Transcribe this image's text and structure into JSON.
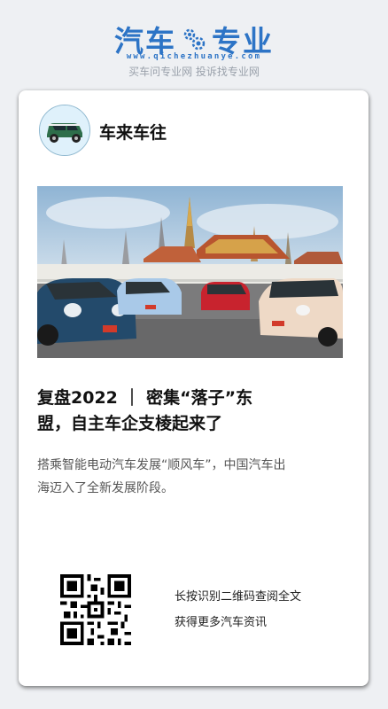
{
  "brand": {
    "logo_left": "汽车",
    "logo_right": "专业",
    "url": "www.qichezhuanye.com",
    "tagline": "买车问专业网 投诉找专业网",
    "color": "#2d74c6"
  },
  "account": {
    "name": "车来车往",
    "avatar_icon": "green-car-icon"
  },
  "article": {
    "image_icon": "cars-in-front-of-temple-photo",
    "title_line1": "复盘2022 ｜ 密集“落子”东",
    "title_line2": "盟，自主车企支棱起来了",
    "desc_line1": "搭乘智能电动汽车发展“顺风车”，中国汽车出",
    "desc_line2": "海迈入了全新发展阶段。"
  },
  "qr": {
    "icon": "qr-code-icon",
    "line1": "长按识别二维码查阅全文",
    "line2": "获得更多汽车资讯"
  }
}
